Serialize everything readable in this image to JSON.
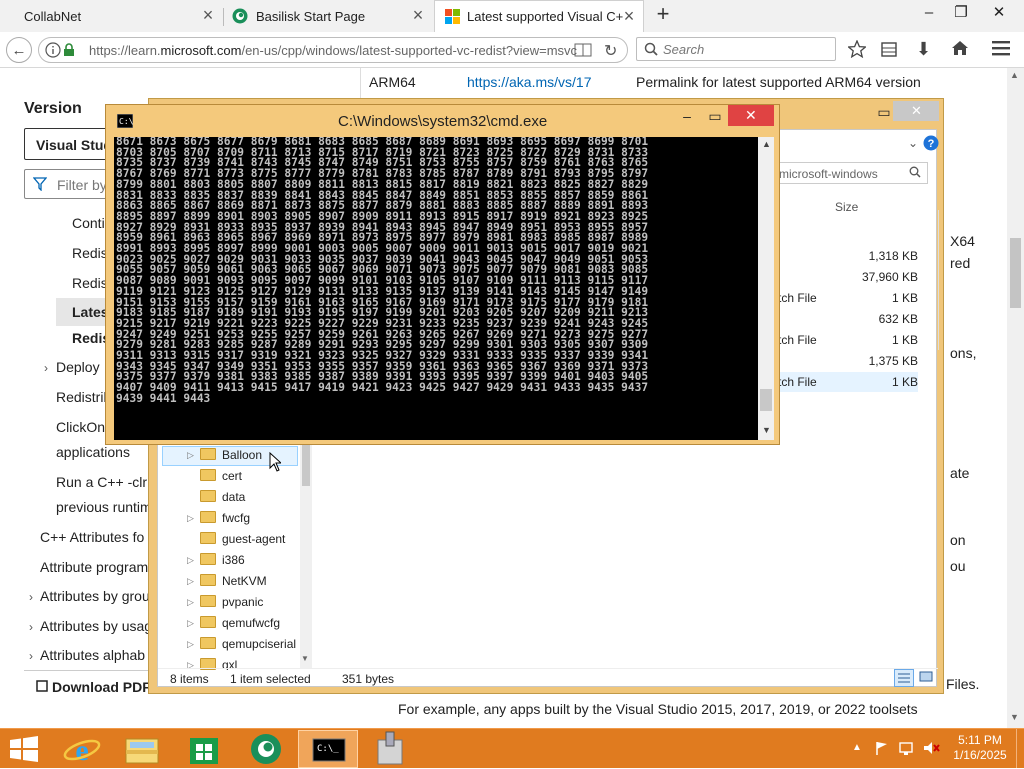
{
  "browser": {
    "tabs": [
      {
        "title": "CollabNet"
      },
      {
        "title": "Basilisk Start Page"
      },
      {
        "title": "Latest supported Visual C+"
      }
    ],
    "url_prefix": "https://learn.",
    "url_domain": "microsoft.com",
    "url_suffix": "/en-us/cpp/windows/latest-supported-vc-redist?view=msvc",
    "search_placeholder": "Search"
  },
  "webpage": {
    "top_row": {
      "col1": "ARM64",
      "col2": "https://aka.ms/vs/17",
      "col3": "Permalink for latest supported ARM64 version"
    },
    "version_label": "Version",
    "version_select": "Visual Stud",
    "filter_placeholder": "Filter by",
    "nav": [
      "Conti",
      "Redis",
      "Redis",
      "Lates",
      "Redis",
      "Deploy",
      "Redistrib",
      "ClickOnc",
      "applications",
      "Run a C++ -clr",
      "previous runtim",
      "C++ Attributes fo",
      "Attribute program",
      "Attributes by grou",
      "Attributes by usag",
      "Attributes alphab"
    ],
    "download_pdf": "Download PDF",
    "bottom_text": "For example, any apps built by the Visual Studio 2015, 2017, 2019, or 2022 toolsets",
    "right_fragments": [
      "X64",
      "red",
      "ons,",
      "ate",
      "on",
      "ou",
      "Files."
    ]
  },
  "explorer": {
    "search_text": "microsoft-windows",
    "size_header": "Size",
    "rows": [
      {
        "name": "",
        "size": "1,318 KB"
      },
      {
        "name": "",
        "size": "37,960 KB"
      },
      {
        "name": "tch File",
        "size": "1 KB"
      },
      {
        "name": "",
        "size": "632 KB"
      },
      {
        "name": "tch File",
        "size": "1 KB"
      },
      {
        "name": "",
        "size": "1,375 KB"
      },
      {
        "name": "tch File",
        "size": "1 KB"
      }
    ],
    "tree": [
      "Balloon",
      "cert",
      "data",
      "fwcfg",
      "guest-agent",
      "i386",
      "NetKVM",
      "pvpanic",
      "qemufwcfg",
      "qemupciserial",
      "qxl"
    ],
    "status_items": "8 items",
    "status_selected": "1 item selected",
    "status_size": "351 bytes"
  },
  "cmd": {
    "title": "C:\\Windows\\system32\\cmd.exe",
    "output": "8671 8673 8675 8677 8679 8681 8683 8685 8687 8689 8691 8693 8695 8697 8699 8701\n8703 8705 8707 8709 8711 8713 8715 8717 8719 8721 8723 8725 8727 8729 8731 8733\n8735 8737 8739 8741 8743 8745 8747 8749 8751 8753 8755 8757 8759 8761 8763 8765\n8767 8769 8771 8773 8775 8777 8779 8781 8783 8785 8787 8789 8791 8793 8795 8797\n8799 8801 8803 8805 8807 8809 8811 8813 8815 8817 8819 8821 8823 8825 8827 8829\n8831 8833 8835 8837 8839 8841 8843 8845 8847 8849 8851 8853 8855 8857 8859 8861\n8863 8865 8867 8869 8871 8873 8875 8877 8879 8881 8883 8885 8887 8889 8891 8893\n8895 8897 8899 8901 8903 8905 8907 8909 8911 8913 8915 8917 8919 8921 8923 8925\n8927 8929 8931 8933 8935 8937 8939 8941 8943 8945 8947 8949 8951 8953 8955 8957\n8959 8961 8963 8965 8967 8969 8971 8973 8975 8977 8979 8981 8983 8985 8987 8989\n8991 8993 8995 8997 8999 9001 9003 9005 9007 9009 9011 9013 9015 9017 9019 9021\n9023 9025 9027 9029 9031 9033 9035 9037 9039 9041 9043 9045 9047 9049 9051 9053\n9055 9057 9059 9061 9063 9065 9067 9069 9071 9073 9075 9077 9079 9081 9083 9085\n9087 9089 9091 9093 9095 9097 9099 9101 9103 9105 9107 9109 9111 9113 9115 9117\n9119 9121 9123 9125 9127 9129 9131 9133 9135 9137 9139 9141 9143 9145 9147 9149\n9151 9153 9155 9157 9159 9161 9163 9165 9167 9169 9171 9173 9175 9177 9179 9181\n9183 9185 9187 9189 9191 9193 9195 9197 9199 9201 9203 9205 9207 9209 9211 9213\n9215 9217 9219 9221 9223 9225 9227 9229 9231 9233 9235 9237 9239 9241 9243 9245\n9247 9249 9251 9253 9255 9257 9259 9261 9263 9265 9267 9269 9271 9273 9275 9277\n9279 9281 9283 9285 9287 9289 9291 9293 9295 9297 9299 9301 9303 9305 9307 9309\n9311 9313 9315 9317 9319 9321 9323 9325 9327 9329 9331 9333 9335 9337 9339 9341\n9343 9345 9347 9349 9351 9353 9355 9357 9359 9361 9363 9365 9367 9369 9371 9373\n9375 9377 9379 9381 9383 9385 9387 9389 9391 9393 9395 9397 9399 9401 9403 9405\n9407 9409 9411 9413 9415 9417 9419 9421 9423 9425 9427 9429 9431 9433 9435 9437\n9439 9441 9443"
  },
  "taskbar": {
    "time": "5:11 PM",
    "date": "1/16/2025",
    "icons": [
      "internet-explorer-icon",
      "file-explorer-icon",
      "store-icon",
      "basilisk-icon",
      "cmd-icon",
      "tools-icon"
    ]
  },
  "colors": {
    "window_frame": "#f4c97c",
    "taskbar": "#e07b1f",
    "close_red": "#e04343"
  }
}
